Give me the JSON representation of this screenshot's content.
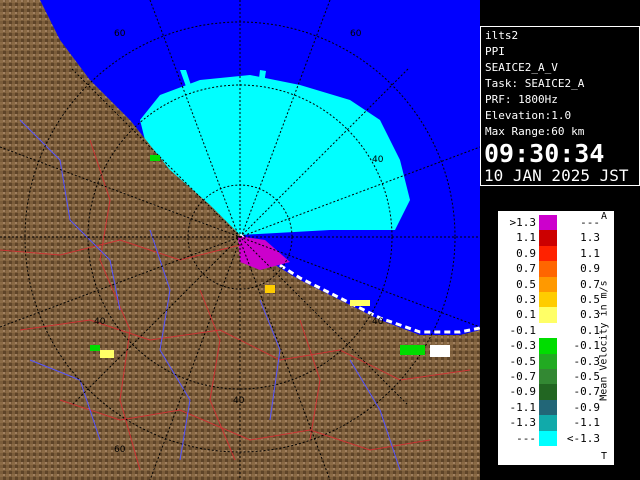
{
  "info": {
    "lines": [
      "ilts2",
      "PPI",
      "SEAICE2_A_V",
      "Task: SEAICE2_A",
      "PRF: 1800Hz",
      "Elevation:1.0",
      "Max Range:60 km"
    ],
    "time": "09:30:34",
    "date": "10 JAN 2025 JST"
  },
  "legend": {
    "title": "Mean Velocity in m/s",
    "corner_top": "A",
    "corner_bottom": "T",
    "rows": [
      {
        "left": ">1.3",
        "right": "---",
        "color": "#cc00cc"
      },
      {
        "left": "1.1",
        "right": "1.3",
        "color": "#cc0000"
      },
      {
        "left": "0.9",
        "right": "1.1",
        "color": "#ff2200"
      },
      {
        "left": "0.7",
        "right": "0.9",
        "color": "#ff6600"
      },
      {
        "left": "0.5",
        "right": "0.7",
        "color": "#ff9900"
      },
      {
        "left": "0.3",
        "right": "0.5",
        "color": "#ffcc00"
      },
      {
        "left": "0.1",
        "right": "0.3",
        "color": "#ffff66"
      },
      {
        "left": "-0.1",
        "right": "0.1",
        "color": "#ffffff"
      },
      {
        "left": "-0.3",
        "right": "-0.1",
        "color": "#00dd00"
      },
      {
        "left": "-0.5",
        "right": "-0.3",
        "color": "#22aa22"
      },
      {
        "left": "-0.7",
        "right": "-0.5",
        "color": "#338833"
      },
      {
        "left": "-0.9",
        "right": "-0.7",
        "color": "#226622"
      },
      {
        "left": "-1.1",
        "right": "-0.9",
        "color": "#226677"
      },
      {
        "left": "-1.3",
        "right": "-1.1",
        "color": "#11aaaa"
      },
      {
        "left": "---",
        "right": "<-1.3",
        "color": "#00ffff"
      }
    ]
  },
  "map": {
    "range_rings_km": [
      20,
      40,
      60
    ],
    "ring_labels": [
      "60",
      "40",
      "40",
      "40",
      "60"
    ],
    "colors": {
      "sea": "#0000ff",
      "land": "#7a5c3a",
      "ring": "#000000",
      "velocity_main": "#00ffff",
      "velocity_near": "#cc00cc",
      "border": "#cc3333",
      "river": "#5555ff"
    }
  }
}
